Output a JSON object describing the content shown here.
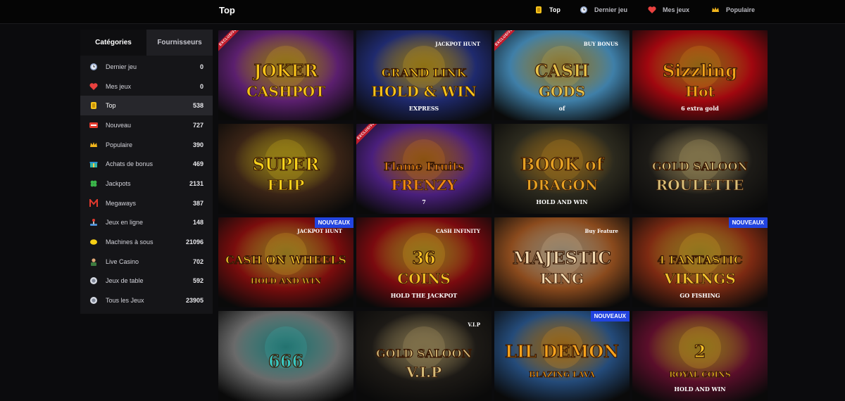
{
  "header": {
    "title": "Top",
    "nav": [
      {
        "label": "Top",
        "icon": "coin-icon",
        "active": true
      },
      {
        "label": "Dernier jeu",
        "icon": "clock-icon",
        "active": false
      },
      {
        "label": "Mes jeux",
        "icon": "heart-icon",
        "active": false
      },
      {
        "label": "Populaire",
        "icon": "crown-icon",
        "active": false
      }
    ]
  },
  "sidebar": {
    "tabs": [
      {
        "label": "Catégories",
        "active": true
      },
      {
        "label": "Fournisseurs",
        "active": false
      }
    ],
    "categories": [
      {
        "label": "Dernier jeu",
        "count": "0",
        "icon": "clock-icon"
      },
      {
        "label": "Mes jeux",
        "count": "0",
        "icon": "heart-icon"
      },
      {
        "label": "Top",
        "count": "538",
        "icon": "coin-icon",
        "active": true
      },
      {
        "label": "Nouveau",
        "count": "727",
        "icon": "new-icon"
      },
      {
        "label": "Populaire",
        "count": "390",
        "icon": "crown-icon"
      },
      {
        "label": "Achats de bonus",
        "count": "469",
        "icon": "gift-icon"
      },
      {
        "label": "Jackpots",
        "count": "2131",
        "icon": "clover-icon"
      },
      {
        "label": "Megaways",
        "count": "387",
        "icon": "megaways-icon"
      },
      {
        "label": "Jeux en ligne",
        "count": "148",
        "icon": "joystick-icon"
      },
      {
        "label": "Machines à sous",
        "count": "21096",
        "icon": "lemon-icon"
      },
      {
        "label": "Live Casino",
        "count": "702",
        "icon": "dealer-icon"
      },
      {
        "label": "Jeux de table",
        "count": "592",
        "icon": "chip-icon"
      },
      {
        "label": "Tous les Jeux",
        "count": "23905",
        "icon": "chip-icon"
      }
    ]
  },
  "games": [
    {
      "line1": "JOKER",
      "line2": "CASHPOT",
      "badge": "",
      "corner": "EXCLUSIVE",
      "bg": "#5b1f6e",
      "accent": "#f4c21a"
    },
    {
      "line1": "GRAND LINK",
      "line2": "HOLD & WIN",
      "badge": "",
      "corner": "",
      "bg": "#1f2a6e",
      "accent": "#f7c41c",
      "stamp": "JACKPOT HUNT",
      "sub": "EXPRESS"
    },
    {
      "line1": "CASH",
      "line2": "GODS",
      "badge": "",
      "corner": "EXCLUSIVE",
      "bg": "#3f7fa8",
      "accent": "#e8c44a",
      "sub": "of",
      "stamp": "BUY BONUS"
    },
    {
      "line1": "Sizzling",
      "line2": "Hot",
      "badge": "",
      "corner": "",
      "bg": "#a0070f",
      "accent": "#f2a41a",
      "sub": "6 extra gold"
    },
    {
      "line1": "SUPER",
      "line2": "FLIP",
      "badge": "",
      "corner": "",
      "bg": "#3a2416",
      "accent": "#f6d21c"
    },
    {
      "line1": "Flame Fruits",
      "line2": "FRENZY",
      "badge": "",
      "corner": "EXCLUSIVE",
      "bg": "#4a1f7c",
      "accent": "#f18a15",
      "sub": "7"
    },
    {
      "line1": "BOOK of",
      "line2": "DRAGON",
      "badge": "",
      "corner": "",
      "bg": "#2c2a1e",
      "accent": "#e4a124",
      "sub": "HOLD AND WIN"
    },
    {
      "line1": "GOLD SALOON",
      "line2": "ROULETTE",
      "badge": "",
      "corner": "",
      "bg": "#1d1b17",
      "accent": "#d9c07a"
    },
    {
      "line1": "CASH ON WHEELS",
      "line2": "HOLD AND WIN",
      "badge": "NOUVEAUX",
      "corner": "",
      "bg": "#7a0d0d",
      "accent": "#f3c42a",
      "stamp": "JACKPOT HUNT"
    },
    {
      "line1": "36",
      "line2": "COINS",
      "badge": "",
      "corner": "",
      "bg": "#7a0a0f",
      "accent": "#f7c325",
      "sub": "HOLD THE JACKPOT",
      "stamp": "CASH INFINITY"
    },
    {
      "line1": "MAJESTIC",
      "line2": "KING",
      "badge": "",
      "corner": "",
      "bg": "#8a4a1d",
      "accent": "#f2d9b0",
      "stamp": "Buy Feature"
    },
    {
      "line1": "4 FANTASTIC",
      "line2": "VIKINGS",
      "badge": "NOUVEAUX",
      "corner": "",
      "bg": "#7d2a12",
      "accent": "#f5c62e",
      "sub": "GO FISHING"
    },
    {
      "line1": "666",
      "line2": "",
      "badge": "",
      "corner": "",
      "bg": "#6a6a6a",
      "accent": "#38c7c0"
    },
    {
      "line1": "GOLD SALOON",
      "line2": "V.I.P",
      "badge": "",
      "corner": "",
      "bg": "#1d1a16",
      "accent": "#d7bd7a",
      "stamp": "V.I.P"
    },
    {
      "line1": "LIL DEMON",
      "line2": "BLAZING LAVA",
      "badge": "NOUVEAUX",
      "corner": "",
      "bg": "#244b7a",
      "accent": "#f7a31c"
    },
    {
      "line1": "2",
      "line2": "ROYAL COINS",
      "badge": "",
      "corner": "",
      "bg": "#5a0e2a",
      "accent": "#f6c326",
      "sub": "HOLD AND WIN"
    }
  ],
  "colors": {
    "accent_badge": "#2244e0",
    "sidebar_bg": "#151518",
    "page_bg": "#0b0b0d"
  }
}
